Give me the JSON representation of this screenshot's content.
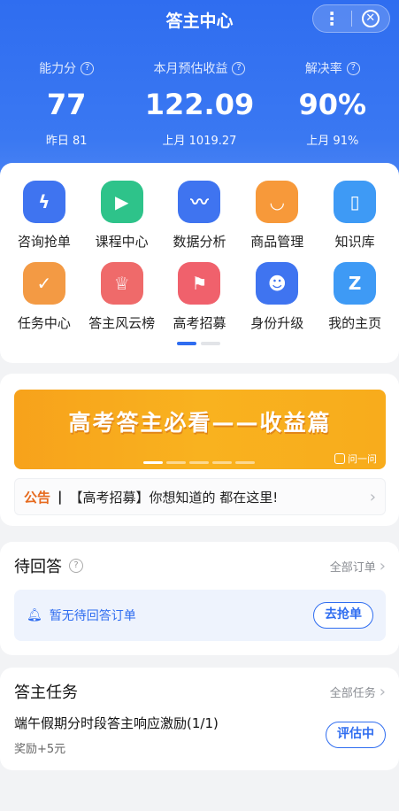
{
  "header": {
    "title": "答主中心",
    "more_icon": "more-vertical-icon",
    "close_icon": "close-circle-icon"
  },
  "stats": [
    {
      "label": "能力分",
      "value": "77",
      "sub": "昨日 81"
    },
    {
      "label": "本月预估收益",
      "value": "122.09",
      "sub": "上月 1019.27"
    },
    {
      "label": "解决率",
      "value": "90%",
      "sub": "上月 91%"
    }
  ],
  "grid": {
    "row1": [
      {
        "label": "咨询抢单",
        "icon": "lightning-icon",
        "color": "#3f74f0"
      },
      {
        "label": "课程中心",
        "icon": "play-icon",
        "color": "#2ec38a"
      },
      {
        "label": "数据分析",
        "icon": "chart-icon",
        "color": "#3f74f0"
      },
      {
        "label": "商品管理",
        "icon": "shop-icon",
        "color": "#f7993a"
      },
      {
        "label": "知识库",
        "icon": "book-icon",
        "color": "#3e9af5"
      }
    ],
    "row2": [
      {
        "label": "任务中心",
        "icon": "task-check-icon",
        "color": "#f39a44"
      },
      {
        "label": "答主风云榜",
        "icon": "trophy-icon",
        "color": "#ef6a6a"
      },
      {
        "label": "高考招募",
        "icon": "flag-icon",
        "color": "#f0616c"
      },
      {
        "label": "身份升级",
        "icon": "user-icon",
        "color": "#3f74f0"
      },
      {
        "label": "我的主页",
        "icon": "home-z-icon",
        "color": "#3e9af5"
      }
    ]
  },
  "banner": {
    "text": "高考答主必看——收益篇",
    "tag": "问一问"
  },
  "notice": {
    "tag": "公告",
    "separator": "|",
    "text": "【高考招募】你想知道的 都在这里!"
  },
  "pending": {
    "title": "待回答",
    "link": "全部订单",
    "empty_text": "暂无待回答订单",
    "button": "去抢单"
  },
  "tasks": {
    "title": "答主任务",
    "link": "全部任务",
    "item_name": "端午假期分时段答主响应激励(1/1)",
    "item_reward": "奖励+5元",
    "item_status": "评估中"
  }
}
